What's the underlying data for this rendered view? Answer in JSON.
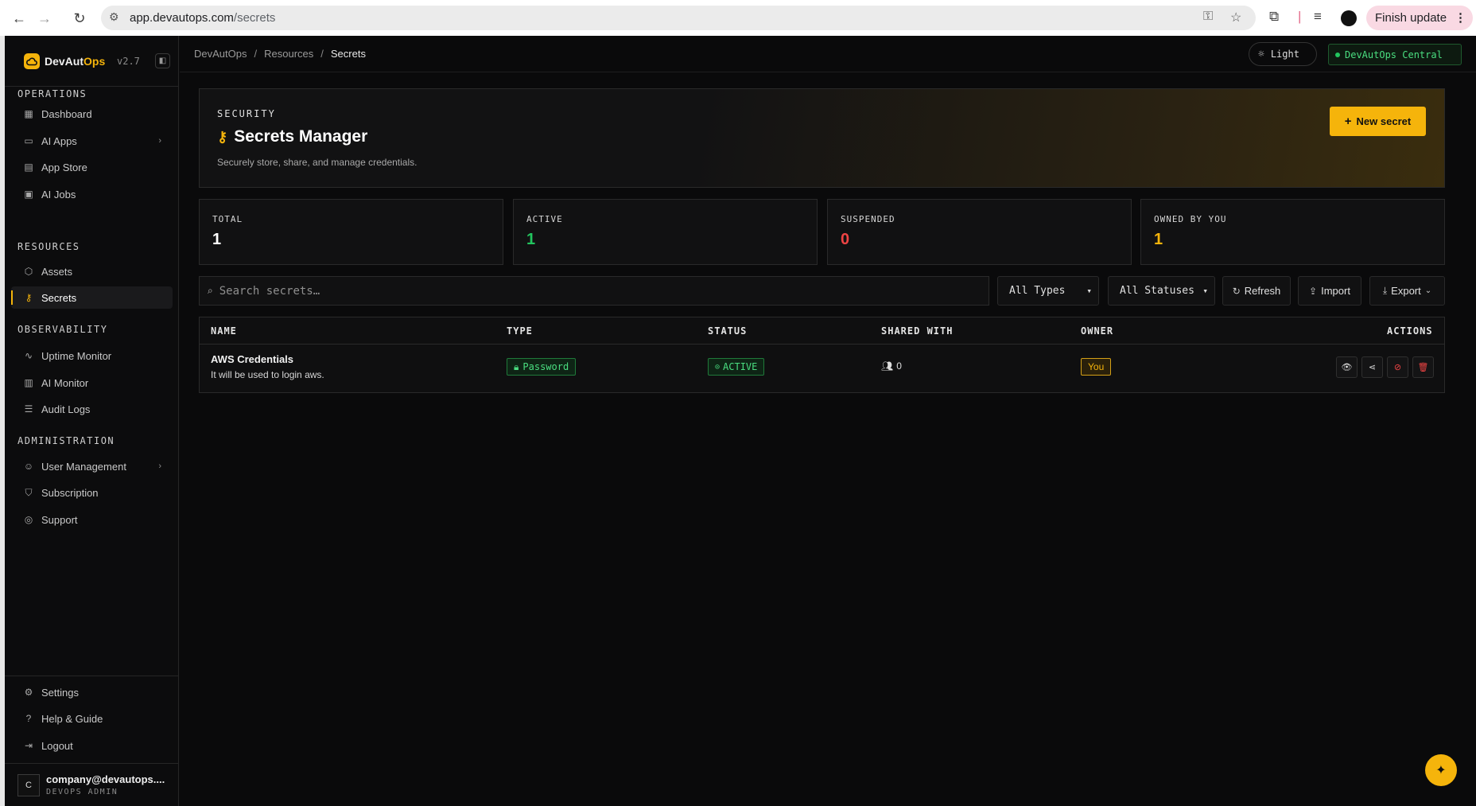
{
  "browser": {
    "url_host": "app.devautops.com",
    "url_path": "/secrets",
    "finish_update": "Finish update"
  },
  "sidebar": {
    "brand_prefix": "DevAut",
    "brand_accent": "Ops",
    "version": "v2.7",
    "sections": {
      "operations": "OPERATIONS",
      "resources": "RESOURCES",
      "observability": "OBSERVABILITY",
      "administration": "ADMINISTRATION"
    },
    "items": {
      "dashboard": "Dashboard",
      "ai_apps": "AI Apps",
      "app_store": "App Store",
      "ai_jobs": "AI Jobs",
      "assets": "Assets",
      "secrets": "Secrets",
      "uptime_monitor": "Uptime Monitor",
      "ai_monitor": "AI Monitor",
      "audit_logs": "Audit Logs",
      "user_management": "User Management",
      "subscription": "Subscription",
      "support": "Support",
      "settings": "Settings",
      "help": "Help & Guide",
      "logout": "Logout"
    },
    "user": {
      "initial": "C",
      "email": "company@devautops....",
      "role": "DEVOPS ADMIN"
    }
  },
  "topbar": {
    "breadcrumb": [
      "DevAutOps",
      "Resources",
      "Secrets"
    ],
    "theme_label": "Light",
    "environment": "DevAutOps Central"
  },
  "hero": {
    "eyebrow": "SECURITY",
    "title": "Secrets Manager",
    "subtitle": "Securely store, share, and manage credentials.",
    "new_button": "New secret"
  },
  "stats": [
    {
      "label": "TOTAL",
      "value": "1",
      "color": "#ffffff"
    },
    {
      "label": "ACTIVE",
      "value": "1",
      "color": "#22c55e"
    },
    {
      "label": "SUSPENDED",
      "value": "0",
      "color": "#ef4444"
    },
    {
      "label": "OWNED BY YOU",
      "value": "1",
      "color": "#f5b40b"
    }
  ],
  "toolbar": {
    "search_placeholder": "Search secrets…",
    "type_filter": "All Types",
    "status_filter": "All Statuses",
    "refresh": "Refresh",
    "import": "Import",
    "export": "Export"
  },
  "table": {
    "headers": {
      "name": "NAME",
      "type": "TYPE",
      "status": "STATUS",
      "shared": "SHARED WITH",
      "owner": "OWNER",
      "actions": "ACTIONS"
    },
    "rows": [
      {
        "name": "AWS Credentials",
        "description": "It will be used to login aws.",
        "type": "Password",
        "status": "ACTIVE",
        "shared_with": "0",
        "owner": "You"
      }
    ]
  },
  "colors": {
    "accent": "#f5b40b",
    "success": "#22c55e",
    "danger": "#ef4444"
  }
}
